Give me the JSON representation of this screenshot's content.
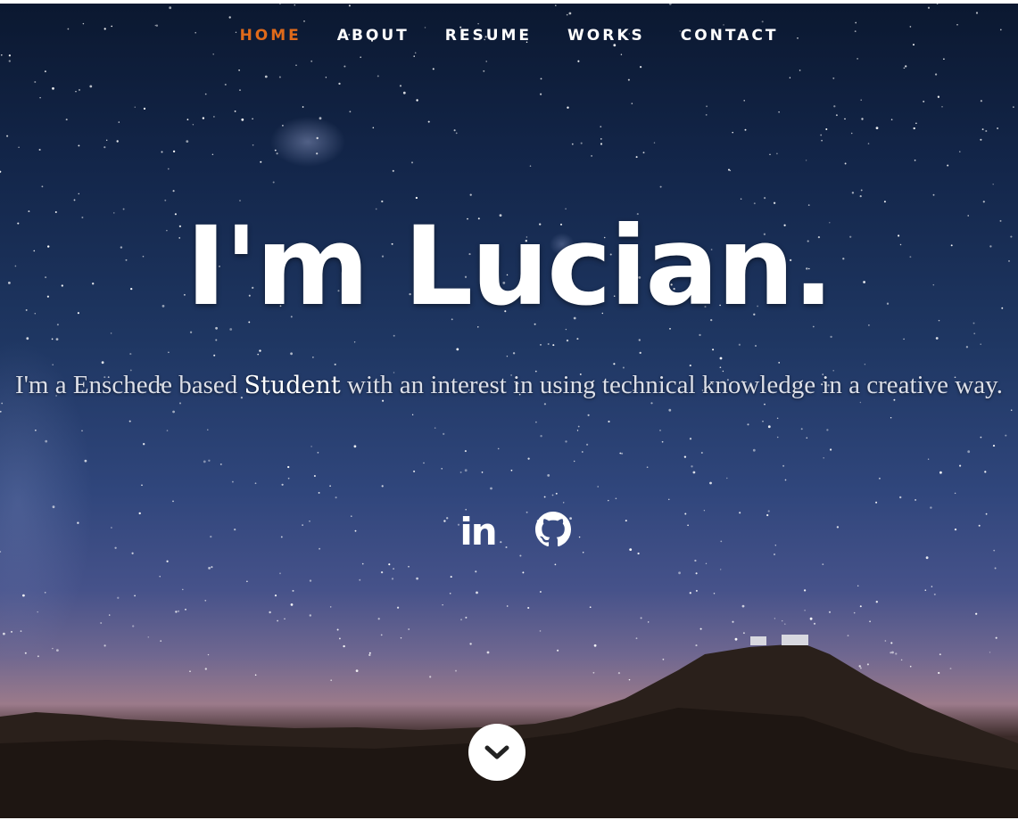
{
  "nav": {
    "items": [
      {
        "label": "HOME",
        "active": true
      },
      {
        "label": "ABOUT",
        "active": false
      },
      {
        "label": "RESUME",
        "active": false
      },
      {
        "label": "WORKS",
        "active": false
      },
      {
        "label": "CONTACT",
        "active": false
      }
    ]
  },
  "hero": {
    "headline": "I'm Lucian.",
    "intro_before": "I'm a Enschede based ",
    "intro_strong": "Student",
    "intro_after": " with an interest in using technical knowledge in a creative way."
  },
  "social": {
    "linkedin_label": "in",
    "icons": [
      "linkedin-icon",
      "github-icon"
    ]
  },
  "scroll": {
    "icon": "chevron-down-icon"
  },
  "colors": {
    "accent": "#e06a1a",
    "text": "#ffffff"
  }
}
